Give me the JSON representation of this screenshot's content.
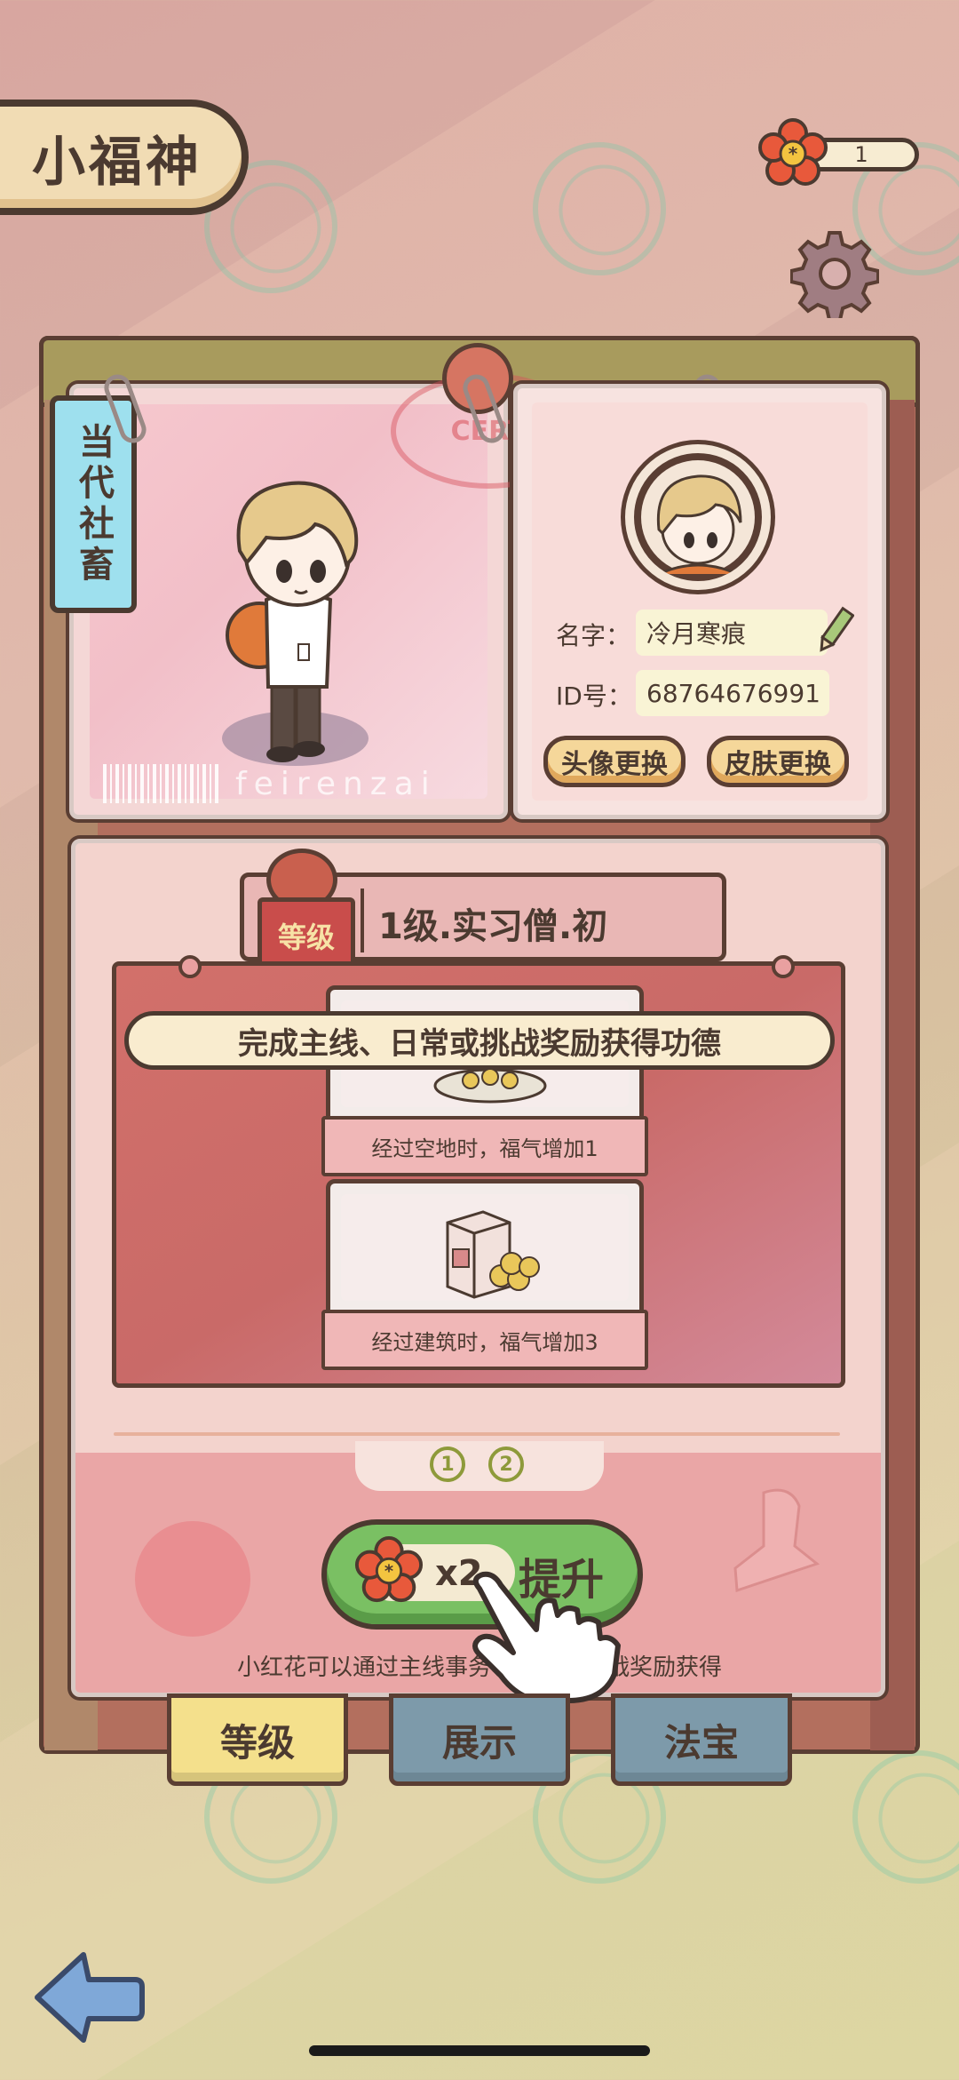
{
  "header": {
    "title": "小福神"
  },
  "currency": {
    "icon": "red-flower-icon",
    "count": "1"
  },
  "settings": {
    "icon": "gear-icon"
  },
  "profile": {
    "role_tag": "当代社畜",
    "watermark": "feirenzai",
    "stamp_text": "CERT",
    "name_label": "名字：",
    "name_value": "冷月寒痕",
    "id_label": "ID号：",
    "id_value": "68764676991",
    "change_avatar_label": "头像更换",
    "change_skin_label": "皮肤更换"
  },
  "level": {
    "tag": "等级",
    "title": "1级.实习僧.初"
  },
  "tip": {
    "banner": "完成主线、日常或挑战奖励获得功德",
    "cards": [
      {
        "caption": "经过空地时，福气增加1"
      },
      {
        "caption": "经过建筑时，福气增加3"
      }
    ]
  },
  "pagination": {
    "pages": [
      "1",
      "2"
    ],
    "current": "1"
  },
  "upgrade": {
    "cost": "x2",
    "label": "提升"
  },
  "hint": "小红花可以通过主线事务、日常或挑战奖励获得",
  "tabs": [
    {
      "label": "等级",
      "active": true
    },
    {
      "label": "展示",
      "active": false
    },
    {
      "label": "法宝",
      "active": false
    }
  ],
  "colors": {
    "accent_green": "#7ac063",
    "tab_active": "#f4e08c",
    "tab_inactive": "#7d9aaa",
    "outline": "#4b3a30"
  }
}
